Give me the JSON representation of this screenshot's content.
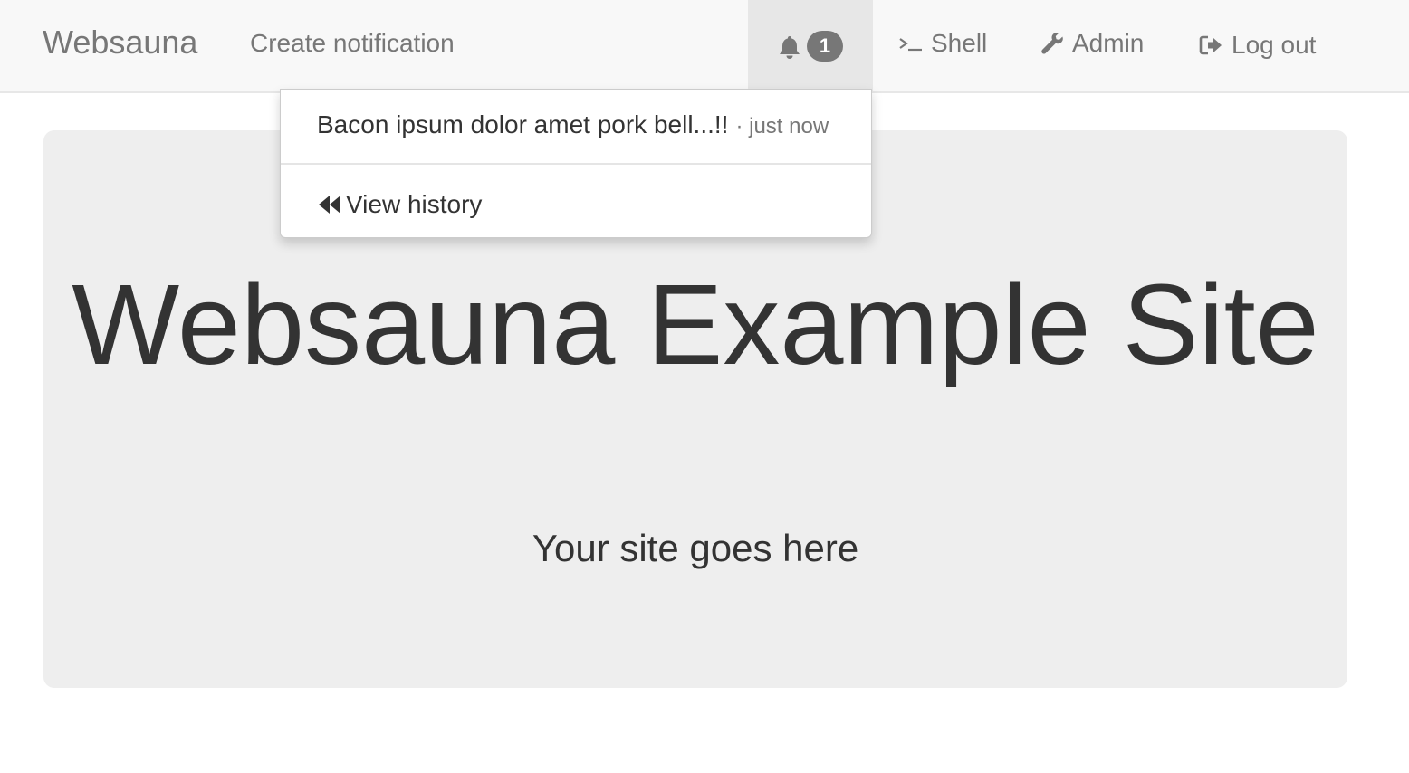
{
  "navbar": {
    "brand": "Websauna",
    "create_notification": "Create notification",
    "notification_count": "1",
    "shell": "Shell",
    "admin": "Admin",
    "logout": "Log out"
  },
  "notifications_dropdown": {
    "items": [
      {
        "text": "Bacon ipsum dolor amet pork bell...!!",
        "time": "· just now"
      }
    ],
    "view_history": "View history"
  },
  "jumbotron": {
    "title": "Websauna Example Site",
    "subtitle": "Your site goes here"
  },
  "colors": {
    "navbar_bg": "#f8f8f8",
    "nav_text": "#777777",
    "badge_bg": "#777777",
    "jumbotron_bg": "#eeeeee",
    "text": "#333333"
  },
  "icons": {
    "bell": "bell-icon",
    "shell": "terminal-icon",
    "admin": "wrench-icon",
    "logout": "log-out-icon",
    "history": "fast-backward-icon"
  }
}
